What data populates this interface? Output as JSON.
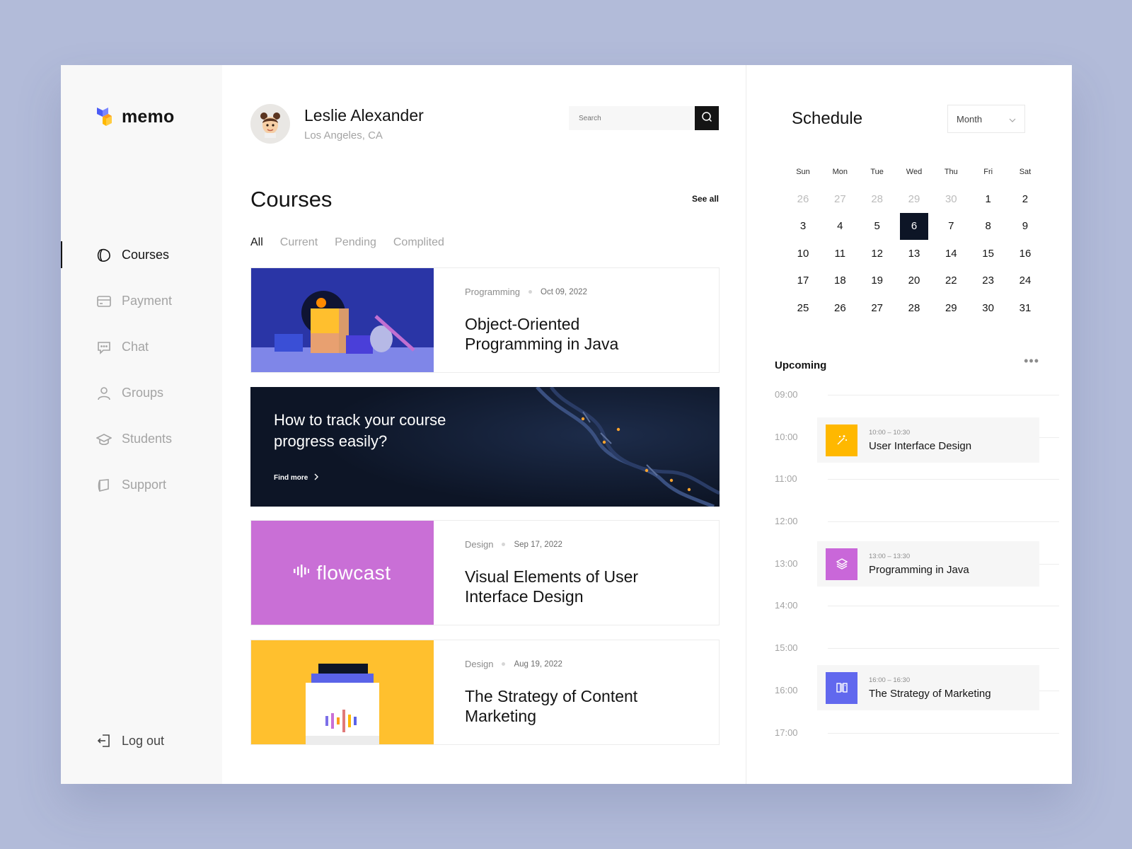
{
  "app": {
    "name": "memo"
  },
  "sidebar": {
    "items": [
      {
        "label": "Courses",
        "icon": "courses-icon",
        "active": true
      },
      {
        "label": "Payment",
        "icon": "card-icon",
        "active": false
      },
      {
        "label": "Chat",
        "icon": "chat-icon",
        "active": false
      },
      {
        "label": "Groups",
        "icon": "user-icon",
        "active": false
      },
      {
        "label": "Students",
        "icon": "graduation-cap-icon",
        "active": false
      },
      {
        "label": "Support",
        "icon": "support-icon",
        "active": false
      }
    ],
    "logout_label": "Log out"
  },
  "profile": {
    "name": "Leslie Alexander",
    "location": "Los Angeles, CA"
  },
  "search": {
    "placeholder": "Search"
  },
  "courses": {
    "title": "Courses",
    "see_all": "See all",
    "tabs": [
      "All",
      "Current",
      "Pending",
      "Complited"
    ],
    "active_tab": "All",
    "cards": [
      {
        "category": "Programming",
        "date": "Oct 09, 2022",
        "title": "Object-Oriented Programming in Java"
      },
      {
        "category": "Design",
        "date": "Sep 17, 2022",
        "title": "Visual Elements of User Interface Design",
        "image_text": "flowcast"
      },
      {
        "category": "Design",
        "date": "Aug 19, 2022",
        "title": "The Strategy of Content Marketing"
      }
    ],
    "banner": {
      "title": "How to track your course progress easily?",
      "link": "Find more"
    }
  },
  "schedule": {
    "title": "Schedule",
    "view": "Month",
    "weekdays": [
      "Sun",
      "Mon",
      "Tue",
      "Wed",
      "Thu",
      "Fri",
      "Sat"
    ],
    "weeks": [
      [
        "26",
        "27",
        "28",
        "29",
        "30",
        "1",
        "2"
      ],
      [
        "3",
        "4",
        "5",
        "6",
        "7",
        "8",
        "9"
      ],
      [
        "10",
        "11",
        "12",
        "13",
        "14",
        "15",
        "16"
      ],
      [
        "17",
        "18",
        "19",
        "20",
        "22",
        "23",
        "24"
      ],
      [
        "25",
        "26",
        "27",
        "28",
        "29",
        "30",
        "31"
      ]
    ],
    "selected_day": "6"
  },
  "upcoming": {
    "title": "Upcoming",
    "hours": [
      "09:00",
      "10:00",
      "11:00",
      "12:00",
      "13:00",
      "14:00",
      "15:00",
      "16:00",
      "17:00"
    ],
    "events": [
      {
        "time": "10:00 – 10:30",
        "title": "User Interface Design",
        "color": "#FFB800",
        "icon": "magic-wand-icon"
      },
      {
        "time": "13:00 – 13:30",
        "title": "Programming in Java",
        "color": "#C967D9",
        "icon": "layers-icon"
      },
      {
        "time": "16:00 – 16:30",
        "title": "The Strategy of Marketing",
        "color": "#6168EE",
        "icon": "book-icon"
      }
    ]
  },
  "colors": {
    "dark": "#0D1526",
    "accent_blue": "#2A35A6",
    "accent_purple": "#C967D9",
    "accent_yellow": "#FFC02E",
    "background": "#B2BBD9"
  }
}
